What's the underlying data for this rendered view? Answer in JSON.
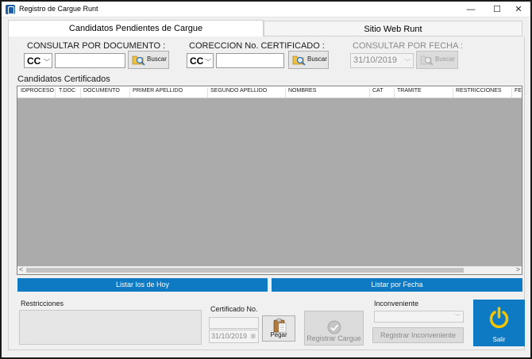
{
  "window": {
    "title": "Registro de Cargue Runt",
    "minimize_glyph": "—",
    "maximize_glyph": "☐",
    "close_glyph": "✕"
  },
  "tabs": [
    {
      "label": "Candidatos Pendientes de Cargue",
      "active": true
    },
    {
      "label": "Sitio Web Runt",
      "active": false
    }
  ],
  "consultar_documento": {
    "label": "CONSULTAR POR DOCUMENTO :",
    "doc_type": "CC",
    "value": "",
    "button_label": "Buscar"
  },
  "correccion": {
    "label": "CORECCION No. CERTIFICADO :",
    "doc_type": "CC",
    "value": "",
    "button_label": "Buscar"
  },
  "consultar_fecha": {
    "label": "CONSULTAR POR FECHA :",
    "date": "31/10/2019",
    "button_label": "Buscar"
  },
  "grid": {
    "title": "Candidatos Certificados",
    "columns": [
      "IDPROCESO",
      "T.DOC",
      "DOCUMENTO",
      "PRIMER APELLIDO",
      "SEGUNDO APELLIDO",
      "NOMBRES",
      "CAT",
      "TRAMITE",
      "RESTRICCIONES",
      "FEC"
    ],
    "rows": []
  },
  "actions": {
    "listar_hoy": "Listar los de Hoy",
    "listar_fecha": "Listar por Fecha"
  },
  "bottom": {
    "restricciones_label": "Restricciones",
    "certificado_label": "Certificado No.",
    "certificado_value": "",
    "certificado_date": "31/10/2019",
    "pegar_label": "Pegar",
    "registrar_cargue_label": "Registrar Cargue",
    "inconveniente_label": "Inconveniente",
    "registrar_inconveniente_label": "Registrar Inconveniente",
    "salir_label": "Salir"
  },
  "colors": {
    "accent_blue": "#0e7ac4",
    "salir_icon": "#f5c400"
  },
  "icons": {
    "search": "magnifier-folder-icon",
    "paste": "clipboard-icon",
    "register": "check-circle-icon",
    "exit": "power-icon"
  }
}
